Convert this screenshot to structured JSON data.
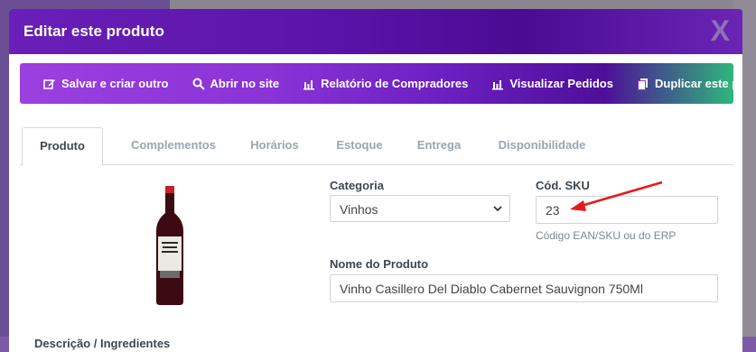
{
  "modal": {
    "title": "Editar este produto",
    "close_label": "X"
  },
  "toolbar": {
    "items": [
      {
        "label": "Salvar e criar outro",
        "icon": "edit-icon"
      },
      {
        "label": "Abrir no site",
        "icon": "search-icon"
      },
      {
        "label": "Relatório de Compradores",
        "icon": "bar-chart-icon"
      },
      {
        "label": "Visualizar Pedidos",
        "icon": "bar-chart-icon"
      },
      {
        "label": "Duplicar este produto",
        "icon": "copy-icon"
      }
    ]
  },
  "tabs": [
    "Produto",
    "Complementos",
    "Horários",
    "Estoque",
    "Entrega",
    "Disponibilidade"
  ],
  "active_tab": "Produto",
  "form": {
    "categoria_label": "Categoria",
    "categoria_value": "Vinhos",
    "sku_label": "Cód. SKU",
    "sku_value": "23",
    "sku_help": "Código EAN/SKU ou do ERP",
    "nome_label": "Nome do Produto",
    "nome_value": "Vinho Casillero Del Diablo Cabernet Sauvignon 750Ml",
    "descricao_label": "Descrição / Ingredientes"
  },
  "colors": {
    "accent": "#6a1fb8",
    "annotation_arrow": "#e8191a"
  }
}
